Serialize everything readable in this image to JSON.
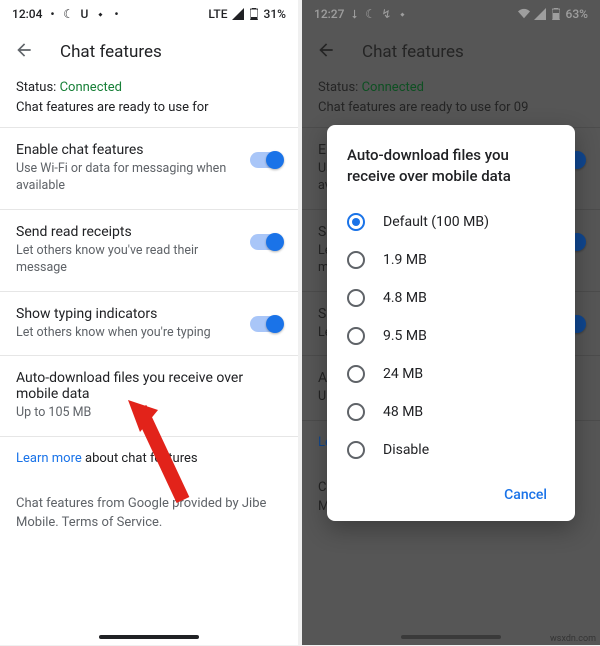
{
  "left": {
    "status": {
      "time": "12:04",
      "net": "LTE",
      "battery": "31%"
    },
    "appbar_title": "Chat features",
    "status_label": "Status:",
    "status_value": "Connected",
    "status_sub": "Chat features are ready to use for",
    "settings": [
      {
        "title": "Enable chat features",
        "sub": "Use Wi-Fi or data for messaging when available",
        "toggle": true
      },
      {
        "title": "Send read receipts",
        "sub": "Let others know you've read their message",
        "toggle": true
      },
      {
        "title": "Show typing indicators",
        "sub": "Let others know when you're typing",
        "toggle": true
      }
    ],
    "autodl": {
      "title": "Auto-download files you receive over mobile data",
      "sub": "Up to 105 MB"
    },
    "learn_more": "Learn more",
    "learn_more_tail": " about chat features",
    "footer": "Chat features from Google provided by Jibe Mobile. Terms of Service."
  },
  "right": {
    "status": {
      "time": "12:27",
      "battery": "63%"
    },
    "appbar_title": "Chat features",
    "status_label": "Status:",
    "status_value": "Connected",
    "status_sub": "Chat features are ready to use for 09",
    "dialog": {
      "title": "Auto-download files you receive over mobile data",
      "options": [
        "Default (100 MB)",
        "1.9 MB",
        "4.8 MB",
        "9.5 MB",
        "24 MB",
        "48 MB",
        "Disable"
      ],
      "selected": 0,
      "cancel": "Cancel"
    }
  },
  "watermark": "wsxdn.com"
}
